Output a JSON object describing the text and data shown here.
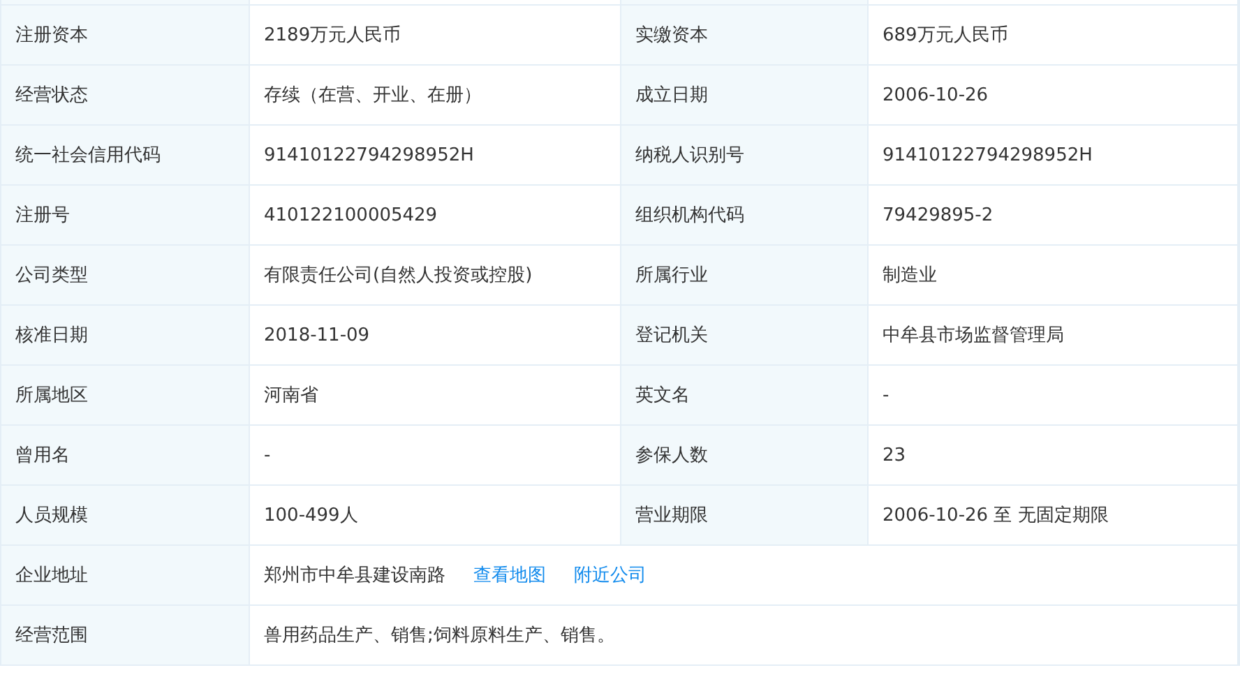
{
  "rows": [
    {
      "kind": "pair",
      "cells": [
        {
          "label": "注册资本",
          "value": "2189万元人民币"
        },
        {
          "label": "实缴资本",
          "value": "689万元人民币"
        }
      ]
    },
    {
      "kind": "pair",
      "cells": [
        {
          "label": "经营状态",
          "value": "存续（在营、开业、在册）"
        },
        {
          "label": "成立日期",
          "value": "2006-10-26"
        }
      ]
    },
    {
      "kind": "pair",
      "cells": [
        {
          "label": "统一社会信用代码",
          "value": "91410122794298952H"
        },
        {
          "label": "纳税人识别号",
          "value": "91410122794298952H"
        }
      ]
    },
    {
      "kind": "pair",
      "cells": [
        {
          "label": "注册号",
          "value": "410122100005429"
        },
        {
          "label": "组织机构代码",
          "value": "79429895-2"
        }
      ]
    },
    {
      "kind": "pair",
      "cells": [
        {
          "label": "公司类型",
          "value": "有限责任公司(自然人投资或控股)"
        },
        {
          "label": "所属行业",
          "value": "制造业"
        }
      ]
    },
    {
      "kind": "pair",
      "cells": [
        {
          "label": "核准日期",
          "value": "2018-11-09"
        },
        {
          "label": "登记机关",
          "value": "中牟县市场监督管理局"
        }
      ]
    },
    {
      "kind": "pair",
      "cells": [
        {
          "label": "所属地区",
          "value": "河南省"
        },
        {
          "label": "英文名",
          "value": "-"
        }
      ]
    },
    {
      "kind": "pair",
      "cells": [
        {
          "label": "曾用名",
          "value": "-"
        },
        {
          "label": "参保人数",
          "value": "23"
        }
      ]
    },
    {
      "kind": "pair",
      "cells": [
        {
          "label": "人员规模",
          "value": "100-499人"
        },
        {
          "label": "营业期限",
          "value": "2006-10-26 至 无固定期限"
        }
      ]
    },
    {
      "kind": "wide",
      "label": "企业地址",
      "value": "郑州市中牟县建设南路",
      "links": [
        "查看地图",
        "附近公司"
      ]
    },
    {
      "kind": "wide",
      "label": "经营范围",
      "value": "兽用药品生产、销售;饲料原料生产、销售。"
    }
  ]
}
